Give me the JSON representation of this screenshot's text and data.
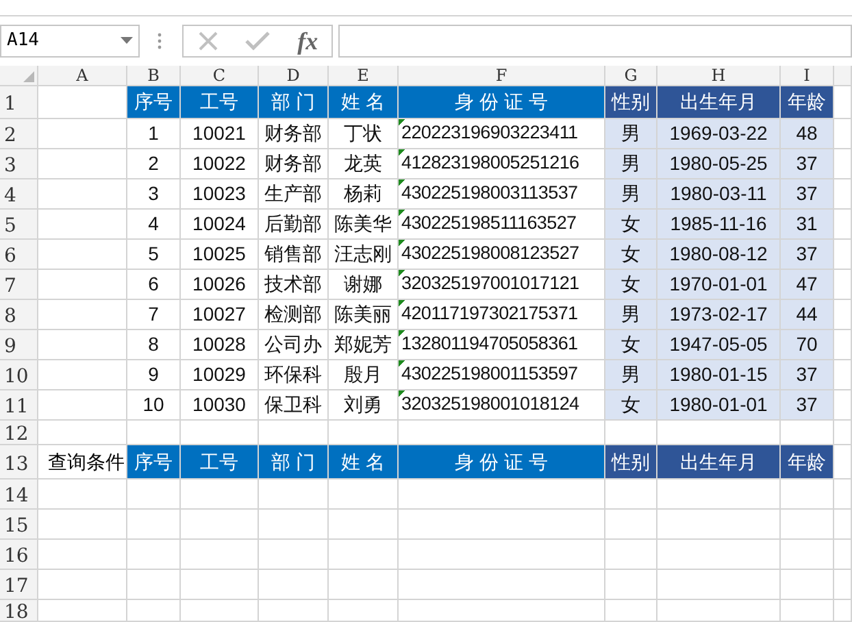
{
  "name_box": {
    "value": "A14"
  },
  "formula_bar": {
    "function_label": "fx"
  },
  "column_headers": [
    "A",
    "B",
    "C",
    "D",
    "E",
    "F",
    "G",
    "H",
    "I"
  ],
  "row_headers": [
    "1",
    "2",
    "3",
    "4",
    "5",
    "6",
    "7",
    "8",
    "9",
    "10",
    "11",
    "12",
    "13",
    "14",
    "15",
    "16",
    "17",
    "18"
  ],
  "table": {
    "headers": [
      "序号",
      "工号",
      "部 门",
      "姓 名",
      "身 份 证 号",
      "性别",
      "出生年月",
      "年龄"
    ],
    "rows": [
      [
        "1",
        "10021",
        "财务部",
        "丁状",
        "220223196903223411",
        "男",
        "1969-03-22",
        "48"
      ],
      [
        "2",
        "10022",
        "财务部",
        "龙英",
        "412823198005251216",
        "男",
        "1980-05-25",
        "37"
      ],
      [
        "3",
        "10023",
        "生产部",
        "杨莉",
        "430225198003113537",
        "男",
        "1980-03-11",
        "37"
      ],
      [
        "4",
        "10024",
        "后勤部",
        "陈美华",
        "430225198511163527",
        "女",
        "1985-11-16",
        "31"
      ],
      [
        "5",
        "10025",
        "销售部",
        "汪志刚",
        "430225198008123527",
        "女",
        "1980-08-12",
        "37"
      ],
      [
        "6",
        "10026",
        "技术部",
        "谢娜",
        "320325197001017121",
        "女",
        "1970-01-01",
        "47"
      ],
      [
        "7",
        "10027",
        "检测部",
        "陈美丽",
        "420117197302175371",
        "男",
        "1973-02-17",
        "44"
      ],
      [
        "8",
        "10028",
        "公司办",
        "郑妮芳",
        "132801194705058361",
        "女",
        "1947-05-05",
        "70"
      ],
      [
        "9",
        "10029",
        "环保科",
        "殷月",
        "430225198001153597",
        "男",
        "1980-01-15",
        "37"
      ],
      [
        "10",
        "10030",
        "保卫科",
        "刘勇",
        "320325198001018124",
        "女",
        "1980-01-01",
        "37"
      ]
    ]
  },
  "query": {
    "label": "查询条件",
    "headers": [
      "序号",
      "工号",
      "部 门",
      "姓 名",
      "身 份 证 号",
      "性别",
      "出生年月",
      "年龄"
    ]
  }
}
